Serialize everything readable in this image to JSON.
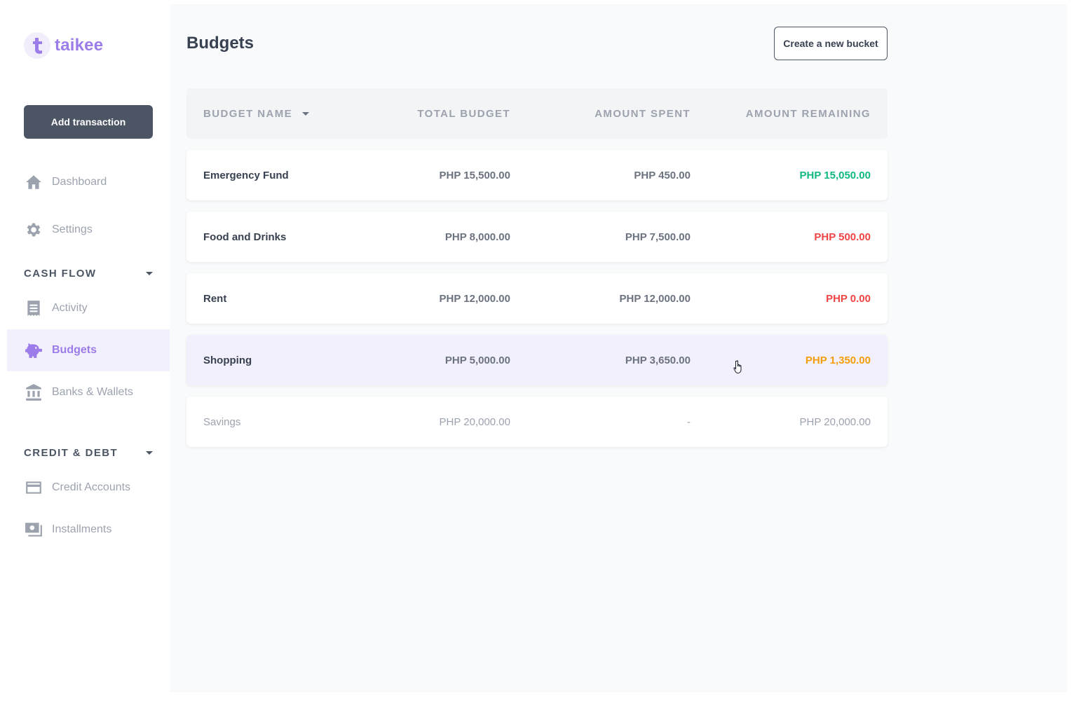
{
  "app": {
    "name": "taikee"
  },
  "sidebar": {
    "add_button": "Add transaction",
    "top_items": [
      {
        "label": "Dashboard",
        "icon": "home-icon"
      },
      {
        "label": "Settings",
        "icon": "gear-icon"
      }
    ],
    "sections": [
      {
        "title": "CASH FLOW",
        "items": [
          {
            "label": "Activity",
            "icon": "receipt-icon"
          },
          {
            "label": "Budgets",
            "icon": "piggy-bank-icon",
            "active": true
          },
          {
            "label": "Banks & Wallets",
            "icon": "bank-icon"
          }
        ]
      },
      {
        "title": "CREDIT & DEBT",
        "items": [
          {
            "label": "Credit Accounts",
            "icon": "credit-card-icon"
          },
          {
            "label": "Installments",
            "icon": "money-stack-icon"
          }
        ]
      }
    ]
  },
  "page": {
    "title": "Budgets",
    "create_button": "Create a new bucket"
  },
  "table": {
    "columns": [
      "BUDGET NAME",
      "TOTAL BUDGET",
      "AMOUNT SPENT",
      "AMOUNT REMAINING"
    ],
    "rows": [
      {
        "name": "Emergency Fund",
        "total": "PHP 15,500.00",
        "spent": "PHP 450.00",
        "remaining": "PHP 15,050.00",
        "status": "good"
      },
      {
        "name": "Food and Drinks",
        "total": "PHP 8,000.00",
        "spent": "PHP 7,500.00",
        "remaining": "PHP 500.00",
        "status": "low"
      },
      {
        "name": "Rent",
        "total": "PHP 12,000.00",
        "spent": "PHP 12,000.00",
        "remaining": "PHP 0.00",
        "status": "low"
      },
      {
        "name": "Shopping",
        "total": "PHP 5,000.00",
        "spent": "PHP 3,650.00",
        "remaining": "PHP 1,350.00",
        "status": "warn"
      },
      {
        "name": "Savings",
        "total": "PHP 20,000.00",
        "spent": "-",
        "remaining": "PHP 20,000.00",
        "status": "muted"
      }
    ]
  },
  "colors": {
    "accent": "#9b7ce8",
    "good": "#10b981",
    "low": "#ef4444",
    "warn": "#f59e0b",
    "muted": "#9ca3af"
  }
}
